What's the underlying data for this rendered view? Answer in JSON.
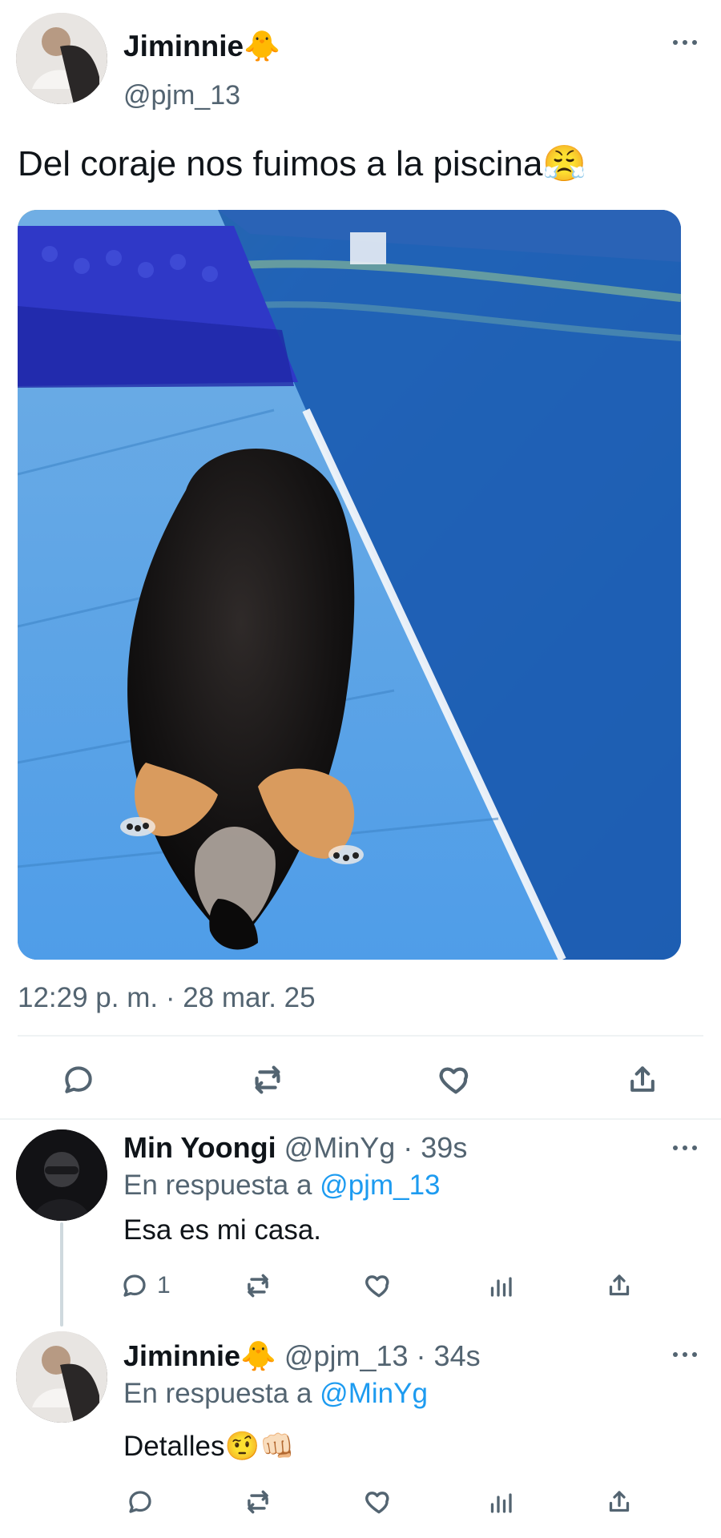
{
  "colors": {
    "text": "#0f1419",
    "muted": "#536471",
    "accent": "#1d9bf0",
    "divider": "#eff3f4"
  },
  "main_tweet": {
    "display_name": "Jiminnie🐥",
    "handle": "@pjm_13",
    "text": "Del coraje nos fuimos a la piscina😤",
    "timestamp": "12:29 p. m. · 28 mar. 25",
    "actions": {
      "reply_icon": "reply-icon",
      "retweet_icon": "retweet-icon",
      "like_icon": "like-icon",
      "share_icon": "share-icon"
    }
  },
  "replies": [
    {
      "display_name": "Min Yoongi",
      "handle": "@MinYg",
      "time": "39s",
      "reply_prefix": "En respuesta a",
      "reply_to": "@pjm_13",
      "text": "Esa es mi casa.",
      "reply_count": "1"
    },
    {
      "display_name": "Jiminnie🐥",
      "handle": "@pjm_13",
      "time": "34s",
      "reply_prefix": "En respuesta a",
      "reply_to": "@MinYg",
      "text": "Detalles🤨👊🏻",
      "reply_count": ""
    }
  ],
  "separator": "·"
}
